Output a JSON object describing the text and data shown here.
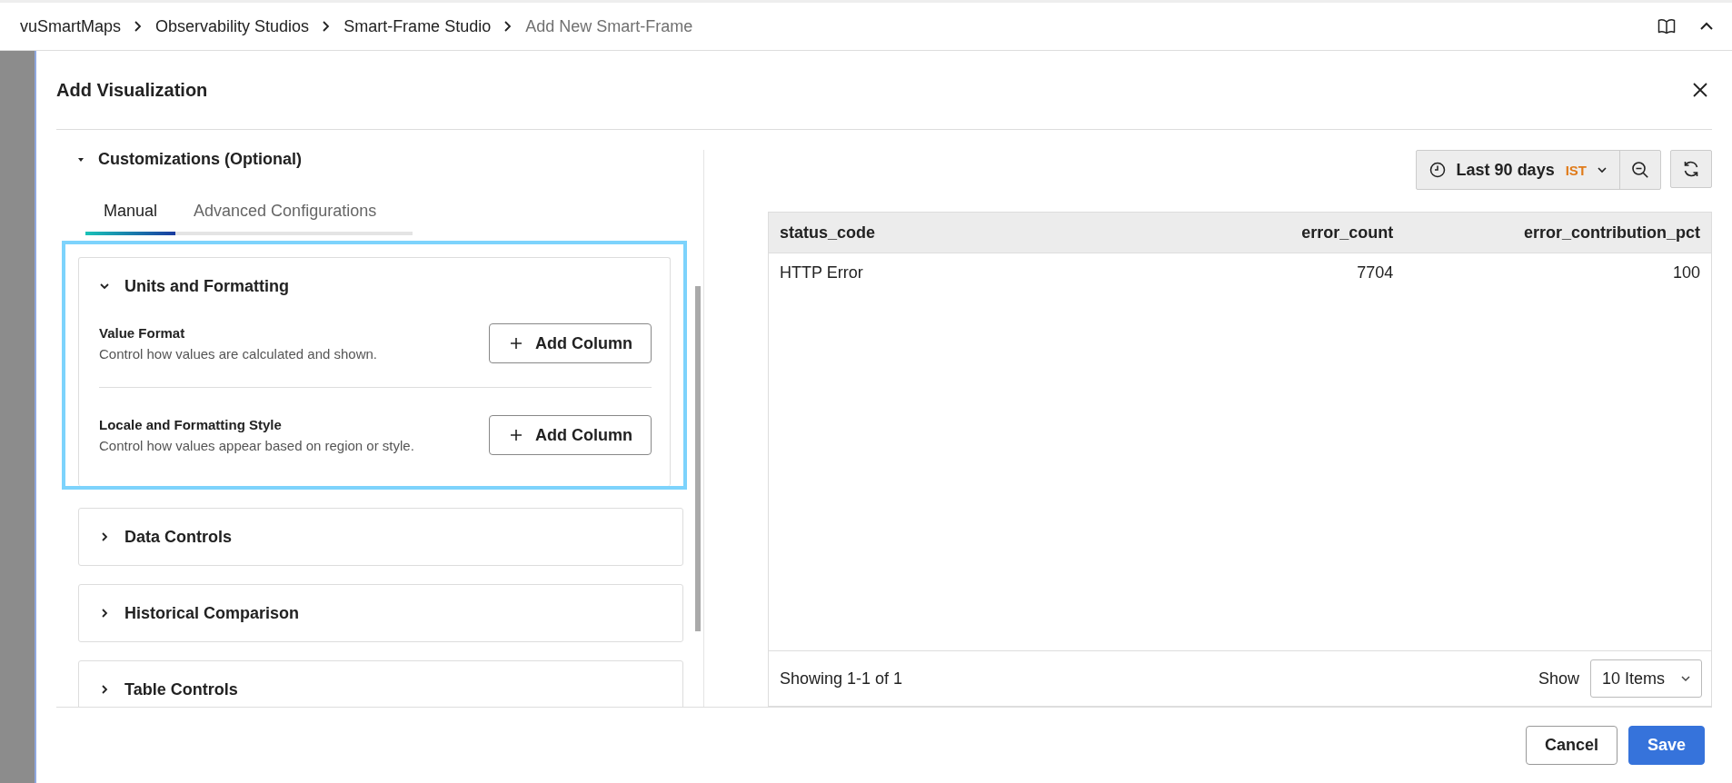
{
  "breadcrumb": [
    {
      "label": "vuSmartMaps",
      "current": false
    },
    {
      "label": "Observability Studios",
      "current": false
    },
    {
      "label": "Smart-Frame Studio",
      "current": false
    },
    {
      "label": "Add New Smart-Frame",
      "current": true
    }
  ],
  "dialog": {
    "title": "Add Visualization",
    "customizations": {
      "title": "Customizations (Optional)",
      "expanded": true
    },
    "tabs": [
      {
        "label": "Manual",
        "selected": true
      },
      {
        "label": "Advanced Configurations",
        "selected": false
      }
    ],
    "sections": [
      {
        "title": "Units and Formatting",
        "expanded": true,
        "highlighted": true,
        "settings": [
          {
            "title": "Value Format",
            "description": "Control how values are calculated and shown.",
            "button": "Add Column"
          },
          {
            "title": "Locale and Formatting Style",
            "description": "Control how values appear based on region or style.",
            "button": "Add Column"
          }
        ]
      },
      {
        "title": "Data Controls",
        "expanded": false,
        "highlighted": false
      },
      {
        "title": "Historical Comparison",
        "expanded": false,
        "highlighted": false
      },
      {
        "title": "Table Controls",
        "expanded": false,
        "highlighted": false
      }
    ],
    "time_range": {
      "label": "Last 90 days",
      "timezone": "IST"
    },
    "table": {
      "columns": [
        {
          "label": "status_code",
          "numeric": false
        },
        {
          "label": "error_count",
          "numeric": true
        },
        {
          "label": "error_contribution_pct",
          "numeric": true
        }
      ],
      "rows": [
        [
          "HTTP Error",
          "7704",
          "100"
        ]
      ],
      "summary": "Showing 1-1 of 1",
      "show_label": "Show",
      "page_size": "10 Items"
    },
    "buttons": {
      "cancel": "Cancel",
      "save": "Save"
    }
  }
}
